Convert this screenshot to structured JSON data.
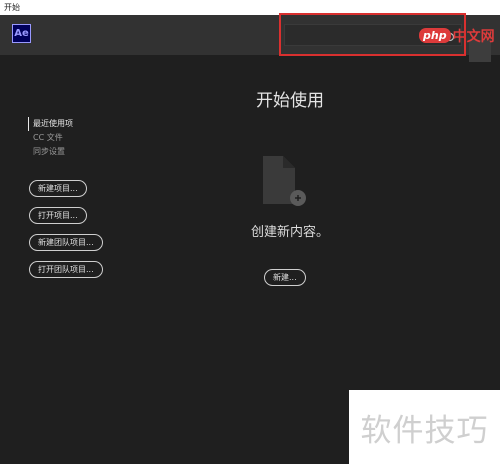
{
  "window": {
    "title": "开始"
  },
  "header": {
    "app_logo": "Ae",
    "search": {
      "placeholder": ""
    }
  },
  "watermarks": {
    "php_badge": "php",
    "php_cn": "中文网",
    "bottom": "软件技巧"
  },
  "sidebar": {
    "nav_items": [
      {
        "label": "最近使用项",
        "active": true
      },
      {
        "label": "CC 文件",
        "active": false
      },
      {
        "label": "同步设置",
        "active": false
      }
    ],
    "buttons": [
      {
        "label": "新建项目..."
      },
      {
        "label": "打开项目..."
      },
      {
        "label": "新建团队项目..."
      },
      {
        "label": "打开团队项目..."
      }
    ]
  },
  "main": {
    "title": "开始使用",
    "empty_message": "创建新内容。",
    "new_button": "新建..."
  },
  "colors": {
    "highlight": "#d9302f",
    "accent": "#9999ff",
    "logo_bg": "#00005b"
  },
  "icons": [
    "search-icon",
    "document-add-icon"
  ]
}
